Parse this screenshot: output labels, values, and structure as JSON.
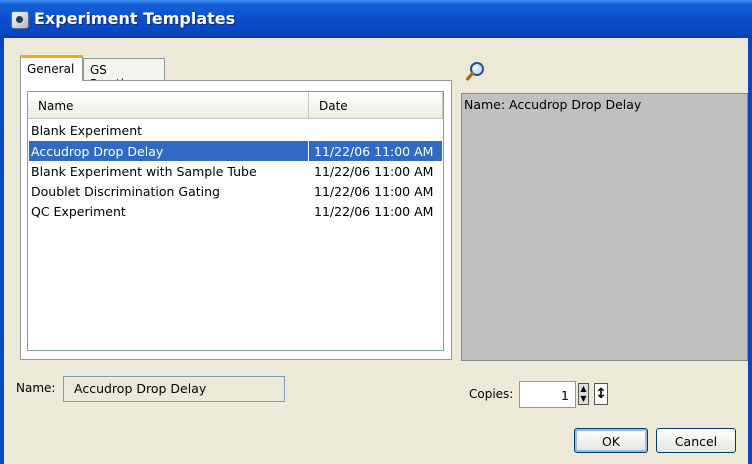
{
  "window": {
    "title": "Experiment Templates"
  },
  "tabs": [
    {
      "label": "General",
      "active": true
    },
    {
      "label": "GS Practice",
      "active": false
    }
  ],
  "list": {
    "columns": [
      "Name",
      "Date"
    ],
    "rows": [
      {
        "name": "Blank Experiment",
        "date": ""
      },
      {
        "name": "Accudrop Drop Delay",
        "date": "11/22/06 11:00 AM",
        "selected": true
      },
      {
        "name": "Blank Experiment with Sample Tube",
        "date": "11/22/06 11:00 AM"
      },
      {
        "name": "Doublet Discrimination Gating",
        "date": "11/22/06 11:00 AM"
      },
      {
        "name": "QC Experiment",
        "date": "11/22/06 11:00 AM"
      }
    ]
  },
  "preview": {
    "text": "Name: Accudrop Drop Delay",
    "icon": "magnifier-icon"
  },
  "name_field": {
    "label": "Name:",
    "value": "Accudrop Drop Delay"
  },
  "copies": {
    "label": "Copies:",
    "value": "1"
  },
  "buttons": {
    "ok": "OK",
    "cancel": "Cancel"
  },
  "colors": {
    "titlebar": "#0a4fcd",
    "selection": "#316ac5",
    "background": "#ece9d8",
    "tab_accent": "#f4a62a"
  }
}
